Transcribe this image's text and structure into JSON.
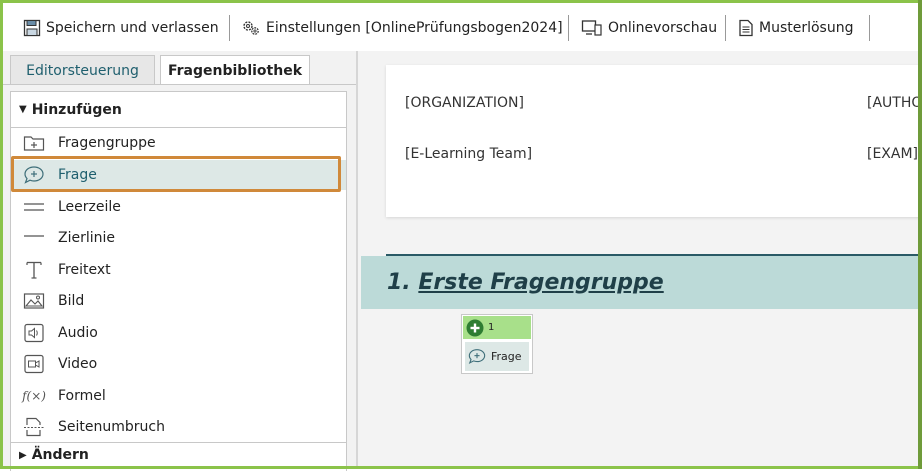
{
  "toolbar": {
    "save_label": "Speichern und verlassen",
    "settings_label": "Einstellungen [OnlinePrüfungsbogen2024]",
    "preview_label": "Onlinevorschau",
    "solution_label": "Musterlösung"
  },
  "tabs": [
    {
      "label": "Editorsteuerung"
    },
    {
      "label": "Fragenbibliothek"
    }
  ],
  "sidebar": {
    "section_add": "Hinzufügen",
    "items": [
      {
        "label": "Fragengruppe",
        "icon": "folder-plus-icon"
      },
      {
        "label": "Frage",
        "icon": "speech-bubble-plus-icon"
      },
      {
        "label": "Leerzeile",
        "icon": "blank-line-icon"
      },
      {
        "label": "Zierlinie",
        "icon": "divider-line-icon"
      },
      {
        "label": "Freitext",
        "icon": "text-icon"
      },
      {
        "label": "Bild",
        "icon": "image-icon"
      },
      {
        "label": "Audio",
        "icon": "audio-icon"
      },
      {
        "label": "Video",
        "icon": "video-icon"
      },
      {
        "label": "Formel",
        "icon": "formula-icon"
      },
      {
        "label": "Seitenumbruch",
        "icon": "page-break-icon"
      }
    ],
    "section_change": "Ändern"
  },
  "document": {
    "header": {
      "left_top": "[ORGANIZATION]",
      "left_bottom": "[E-Learning Team]",
      "right_top": "[AUTHO",
      "right_bottom": "[EXAM]"
    },
    "group": {
      "number": "1.",
      "title": "Erste Fragengruppe"
    },
    "question_widget": {
      "number": "1",
      "label": "Frage"
    }
  },
  "colors": {
    "accent_border": "#8bc34a",
    "selection_outline": "#d0893a",
    "group_bar": "#bcdad8",
    "widget_green": "#a8e08a"
  }
}
